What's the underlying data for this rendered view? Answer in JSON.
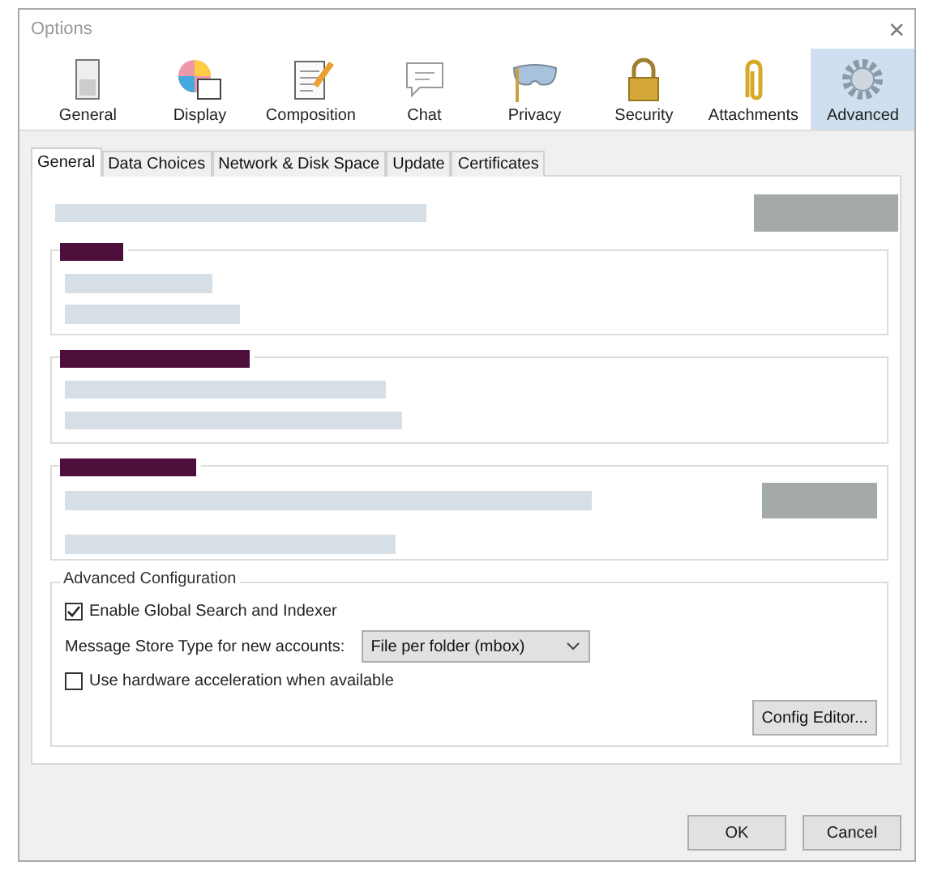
{
  "window": {
    "title": "Options",
    "close": "×"
  },
  "toolbar": [
    {
      "label": "General",
      "kind": "general",
      "selected": false
    },
    {
      "label": "Display",
      "kind": "display",
      "selected": false
    },
    {
      "label": "Composition",
      "kind": "composition",
      "selected": false
    },
    {
      "label": "Chat",
      "kind": "chat",
      "selected": false
    },
    {
      "label": "Privacy",
      "kind": "privacy",
      "selected": false
    },
    {
      "label": "Security",
      "kind": "security",
      "selected": false
    },
    {
      "label": "Attachments",
      "kind": "attachments",
      "selected": false
    },
    {
      "label": "Advanced",
      "kind": "advanced",
      "selected": true
    }
  ],
  "tabs": [
    {
      "label": "General",
      "selected": true
    },
    {
      "label": "Data Choices",
      "selected": false
    },
    {
      "label": "Network & Disk Space",
      "selected": false
    },
    {
      "label": "Update",
      "selected": false
    },
    {
      "label": "Certificates",
      "selected": false
    }
  ],
  "advanced_configuration": {
    "legend": "Advanced Configuration",
    "global_search": {
      "label": "Enable Global Search and Indexer",
      "checked": true
    },
    "store_type": {
      "label": "Message Store Type for new accounts:",
      "value": "File per folder (mbox)"
    },
    "hardware_acceleration": {
      "label": "Use hardware acceleration when available",
      "checked": false
    },
    "config_button": "Config Editor..."
  },
  "buttons": [
    "OK",
    "Cancel"
  ]
}
